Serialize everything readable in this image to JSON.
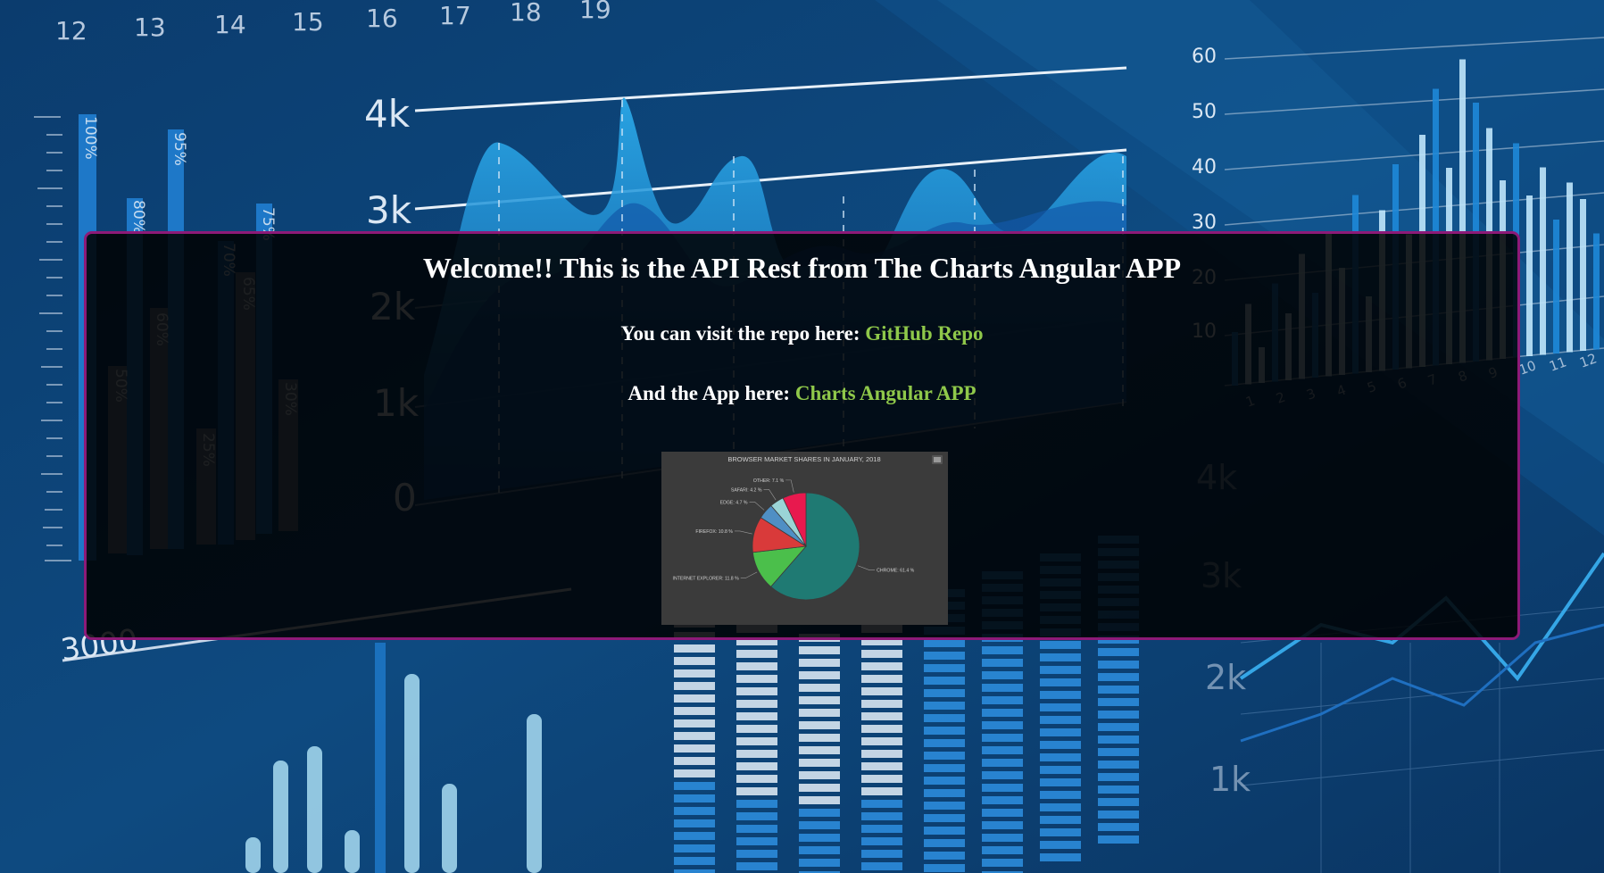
{
  "page": {
    "heading": "Welcome!! This is the API Rest from The Charts Angular APP",
    "repo_prefix": "You can visit the repo here: ",
    "repo_link": "GitHub Repo",
    "app_prefix": "And the App here: ",
    "app_link": "Charts Angular APP",
    "link_color": "#8fc84a",
    "border_color": "#8d1a78"
  },
  "background": {
    "top_axis_labels": [
      "12",
      "13",
      "14",
      "15",
      "16",
      "17",
      "18",
      "19"
    ],
    "area_axis_labels": [
      "4k",
      "3k",
      "2k",
      "1k",
      "0"
    ],
    "right_axis_labels": [
      "60",
      "50",
      "40",
      "30",
      "20",
      "10"
    ],
    "right_x_labels": [
      "1",
      "2",
      "3",
      "4",
      "5",
      "6",
      "7",
      "8",
      "9",
      "10",
      "11",
      "12"
    ],
    "percent_labels": [
      "100%",
      "80%",
      "95%",
      "75%",
      "50%",
      "60%",
      "25%",
      "70%",
      "65%",
      "30%"
    ],
    "lower_right_labels": [
      "4k",
      "3k",
      "2k",
      "1k"
    ],
    "bottom_left_label": "3000"
  },
  "chart_data": {
    "type": "pie",
    "title": "BROWSER MARKET SHARES IN JANUARY, 2018",
    "menu_icon": "hamburger-menu-icon",
    "categories": [
      "Chrome",
      "Internet Explorer",
      "Firefox",
      "Edge",
      "Safari",
      "Other"
    ],
    "labels": [
      "CHROME: 61.4 %",
      "INTERNET EXPLORER: 11.8 %",
      "FIREFOX: 10.8 %",
      "EDGE: 4.7 %",
      "SAFARI: 4.2 %",
      "OTHER: 7.1 %"
    ],
    "values": [
      61.4,
      11.8,
      10.8,
      4.7,
      4.2,
      7.1
    ],
    "colors": [
      "#1f7a73",
      "#4bbf4b",
      "#d93a3a",
      "#4f8fc4",
      "#9ad4d6",
      "#e8194e"
    ]
  }
}
